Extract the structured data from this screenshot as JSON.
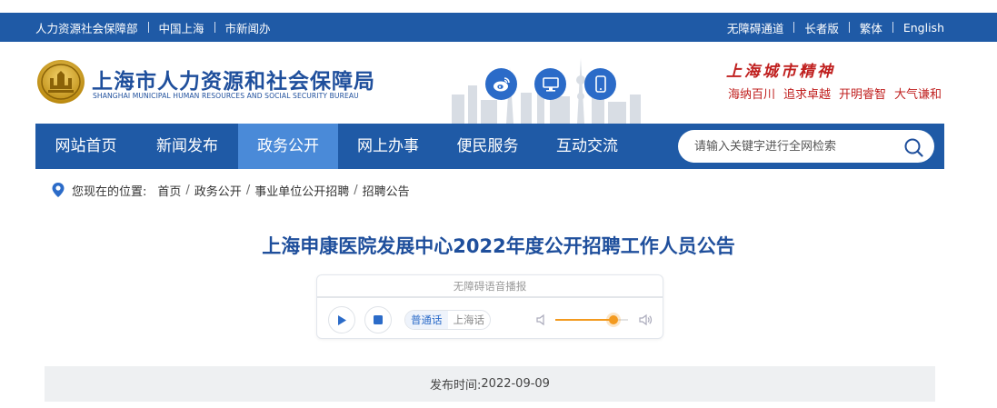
{
  "topbar": {
    "left_links": [
      "人力资源社会保障部",
      "中国上海",
      "市新闻办"
    ],
    "right_links": [
      "无障碍通道",
      "长者版",
      "繁体",
      "English"
    ],
    "color": "#1f5aa6"
  },
  "header": {
    "title": "上海市人力资源和社会保障局",
    "subtitle": "SHANGHAI MUNICIPAL HUMAN RESOURCES AND SOCIAL SECURITY BUREAU",
    "emblem_text": "上海市人力资源和社会保障局",
    "spirit_title": "上海城市精神",
    "spirit_words": [
      "海纳百川",
      "追求卓越",
      "开明睿智",
      "大气谦和"
    ],
    "icons": [
      "weibo-icon",
      "desktop-icon",
      "mobile-icon"
    ]
  },
  "nav": {
    "items": [
      "网站首页",
      "新闻发布",
      "政务公开",
      "网上办事",
      "便民服务",
      "互动交流"
    ],
    "active_index": 2,
    "search_placeholder": "请输入关键字进行全网检索"
  },
  "breadcrumb": {
    "label": "您现在的位置:",
    "items": [
      "首页",
      "政务公开",
      "事业单位公开招聘",
      "招聘公告"
    ]
  },
  "article": {
    "title": "上海申康医院发展中心2022年度公开招聘工作人员公告"
  },
  "player": {
    "title": "无障碍语音播报",
    "languages": [
      "普通话",
      "上海话"
    ],
    "active_language": 0,
    "volume_fraction": 0.8,
    "accent": "#f39a1f"
  },
  "publish": {
    "label": "发布时间:",
    "date": "2022-09-09"
  }
}
